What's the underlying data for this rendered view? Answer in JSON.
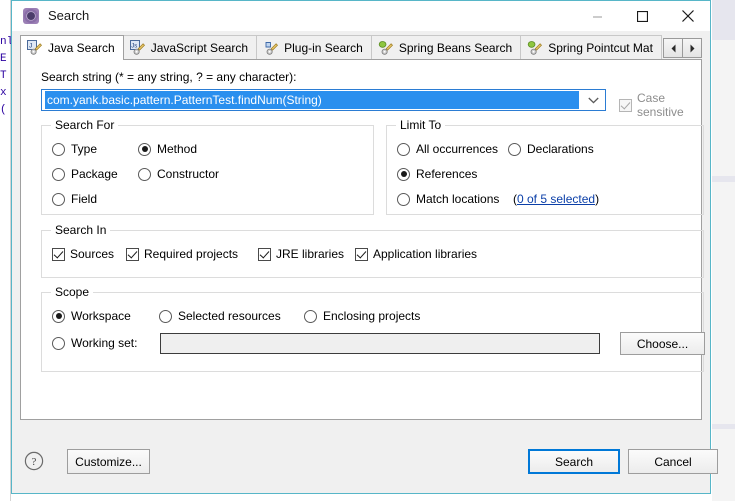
{
  "window": {
    "title": "Search",
    "icon": "search-gear-icon",
    "controls": {
      "minimize": "minimize-icon",
      "maximize": "maximize-icon",
      "close": "close-icon"
    },
    "border_color": "#57b6c8"
  },
  "background": {
    "code_snippet": "nl\nE\nT\nx\n("
  },
  "tabs": {
    "items": [
      {
        "label": "Java Search",
        "icon": "java-search-icon",
        "active": true,
        "truncated": false
      },
      {
        "label": "JavaScript Search",
        "icon": "javascript-search-icon",
        "active": false,
        "truncated": false
      },
      {
        "label": "Plug-in Search",
        "icon": "plugin-search-icon",
        "active": false,
        "truncated": false
      },
      {
        "label": "Spring Beans Search",
        "icon": "spring-beans-search-icon",
        "active": false,
        "truncated": false
      },
      {
        "label": "Spring Pointcut Mat",
        "icon": "spring-pointcut-search-icon",
        "active": false,
        "truncated": true
      }
    ],
    "scroll_left": "chevron-left-icon",
    "scroll_right": "chevron-right-icon"
  },
  "search_string": {
    "label": "Search string (* = any string, ? = any character):",
    "value": "com.yank.basic.pattern.PatternTest.findNum(String)",
    "placeholder": "",
    "dropdown_icon": "chevron-down-icon",
    "selection_color": "#2a8fee"
  },
  "case_sensitive": {
    "label": "Case sensitive",
    "checked": true,
    "disabled": true
  },
  "search_for": {
    "title": "Search For",
    "options": [
      {
        "label": "Type",
        "selected": false
      },
      {
        "label": "Method",
        "selected": true
      },
      {
        "label": "Package",
        "selected": false
      },
      {
        "label": "Constructor",
        "selected": false
      },
      {
        "label": "Field",
        "selected": false
      }
    ]
  },
  "limit_to": {
    "title": "Limit To",
    "options": [
      {
        "label": "All occurrences",
        "selected": false
      },
      {
        "label": "Declarations",
        "selected": false
      },
      {
        "label": "References",
        "selected": true
      },
      {
        "label": "Match locations",
        "selected": false
      }
    ],
    "match_locations_link": {
      "open_paren": "(",
      "text": "0 of 5 selected",
      "close_paren": ")",
      "color": "#0b3fa8"
    }
  },
  "search_in": {
    "title": "Search In",
    "options": [
      {
        "label": "Sources",
        "checked": true
      },
      {
        "label": "Required projects",
        "checked": true
      },
      {
        "label": "JRE libraries",
        "checked": true
      },
      {
        "label": "Application libraries",
        "checked": true
      }
    ]
  },
  "scope": {
    "title": "Scope",
    "options": [
      {
        "label": "Workspace",
        "selected": true
      },
      {
        "label": "Selected resources",
        "selected": false
      },
      {
        "label": "Enclosing projects",
        "selected": false
      },
      {
        "label": "Working set:",
        "selected": false
      }
    ],
    "working_set_value": "",
    "choose_button": "Choose..."
  },
  "footer": {
    "help_icon": "help-icon",
    "customize_label": "Customize...",
    "search_label": "Search",
    "cancel_label": "Cancel",
    "default_button_accent": "#0078d7"
  }
}
